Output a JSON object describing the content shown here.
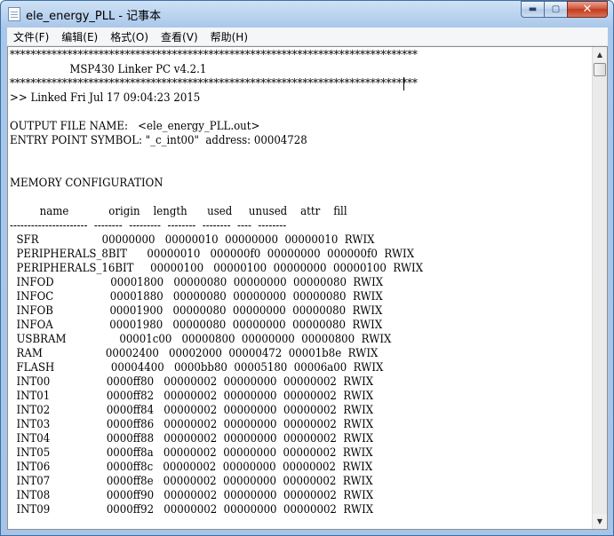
{
  "window": {
    "title": "ele_energy_PLL - 记事本",
    "controls": {
      "minimize": "▬",
      "maximize": "▢",
      "close": "✕"
    }
  },
  "menu": [
    "文件(F)",
    "编辑(E)",
    "格式(O)",
    "查看(V)",
    "帮助(H)"
  ],
  "document": {
    "lines": [
      "******************************************************************************",
      "                  MSP430 Linker PC v4.2.1",
      "******************************************************************************",
      ">> Linked Fri Jul 17 09:04:23 2015",
      "",
      "OUTPUT FILE NAME:   <ele_energy_PLL.out>",
      "ENTRY POINT SYMBOL: \"_c_int00\"  address: 00004728",
      "",
      "",
      "MEMORY CONFIGURATION",
      "",
      "         name            origin    length      used     unused    attr    fill",
      "----------------------  --------  ---------  --------  --------  ----  --------",
      "  SFR                   00000000   00000010  00000000  00000010  RWIX",
      "  PERIPHERALS_8BIT      00000010   000000f0  00000000  000000f0  RWIX",
      "  PERIPHERALS_16BIT     00000100   00000100  00000000  00000100  RWIX",
      "  INFOD                 00001800   00000080  00000000  00000080  RWIX",
      "  INFOC                 00001880   00000080  00000000  00000080  RWIX",
      "  INFOB                 00001900   00000080  00000000  00000080  RWIX",
      "  INFOA                 00001980   00000080  00000000  00000080  RWIX",
      "  USBRAM                00001c00   00000800  00000000  00000800  RWIX",
      "  RAM                   00002400   00002000  00000472  00001b8e  RWIX",
      "  FLASH                 00004400   0000bb80  00005180  00006a00  RWIX",
      "  INT00                 0000ff80   00000002  00000000  00000002  RWIX",
      "  INT01                 0000ff82   00000002  00000000  00000002  RWIX",
      "  INT02                 0000ff84   00000002  00000000  00000002  RWIX",
      "  INT03                 0000ff86   00000002  00000000  00000002  RWIX",
      "  INT04                 0000ff88   00000002  00000000  00000002  RWIX",
      "  INT05                 0000ff8a   00000002  00000000  00000002  RWIX",
      "  INT06                 0000ff8c   00000002  00000000  00000002  RWIX",
      "  INT07                 0000ff8e   00000002  00000000  00000002  RWIX",
      "  INT08                 0000ff90   00000002  00000000  00000002  RWIX",
      "  INT09                 0000ff92   00000002  00000000  00000002  RWIX"
    ]
  },
  "scrollbar": {
    "up_arrow": "▲",
    "down_arrow": "▼",
    "position": 0.0
  }
}
